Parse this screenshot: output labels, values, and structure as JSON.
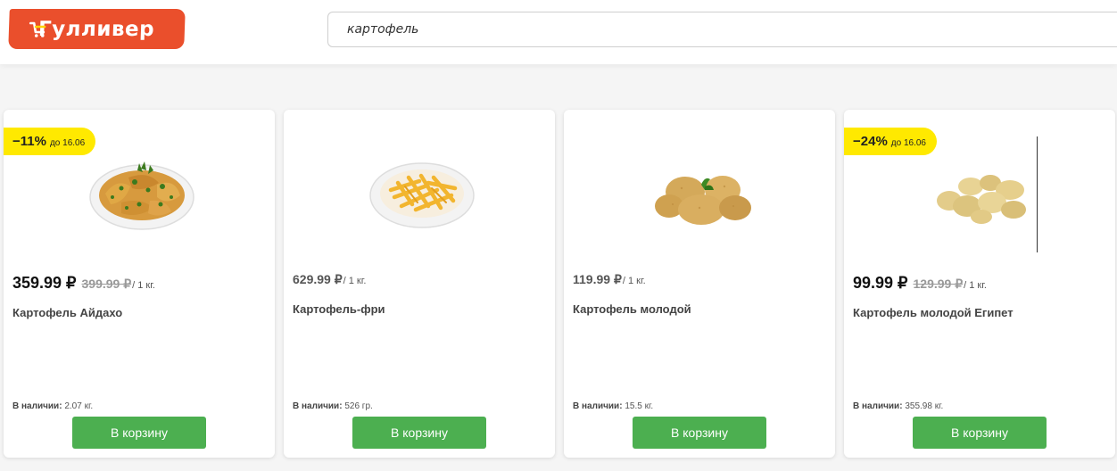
{
  "header": {
    "logo_text": "Гулливер",
    "search_value": "картофель"
  },
  "products": [
    {
      "badge_pct": "−11%",
      "badge_until": "до 16.06",
      "price": "359.99 ₽",
      "old_price": "399.99 ₽",
      "unit": "/ 1 кг.",
      "name": "Картофель Айдахо",
      "stock_label": "В наличии:",
      "stock_value": "2.07 кг.",
      "button": "В корзину",
      "image": "potato-wedges-plate"
    },
    {
      "price": "629.99 ₽",
      "unit": "/ 1 кг.",
      "name": "Картофель-фри",
      "stock_label": "В наличии:",
      "stock_value": "526 гр.",
      "button": "В корзину",
      "image": "french-fries-plate"
    },
    {
      "price": "119.99 ₽",
      "unit": "/ 1 кг.",
      "name": "Картофель молодой",
      "stock_label": "В наличии:",
      "stock_value": "15.5 кг.",
      "button": "В корзину",
      "image": "young-potatoes"
    },
    {
      "badge_pct": "−24%",
      "badge_until": "до 16.06",
      "price": "99.99 ₽",
      "old_price": "129.99 ₽",
      "unit": "/ 1 кг.",
      "name": "Картофель молодой Египет",
      "stock_label": "В наличии:",
      "stock_value": "355.98 кг.",
      "button": "В корзину",
      "image": "egypt-potatoes"
    }
  ],
  "colors": {
    "brand": "#ea4f2c",
    "badge": "#ffe900",
    "button": "#4caf50"
  }
}
